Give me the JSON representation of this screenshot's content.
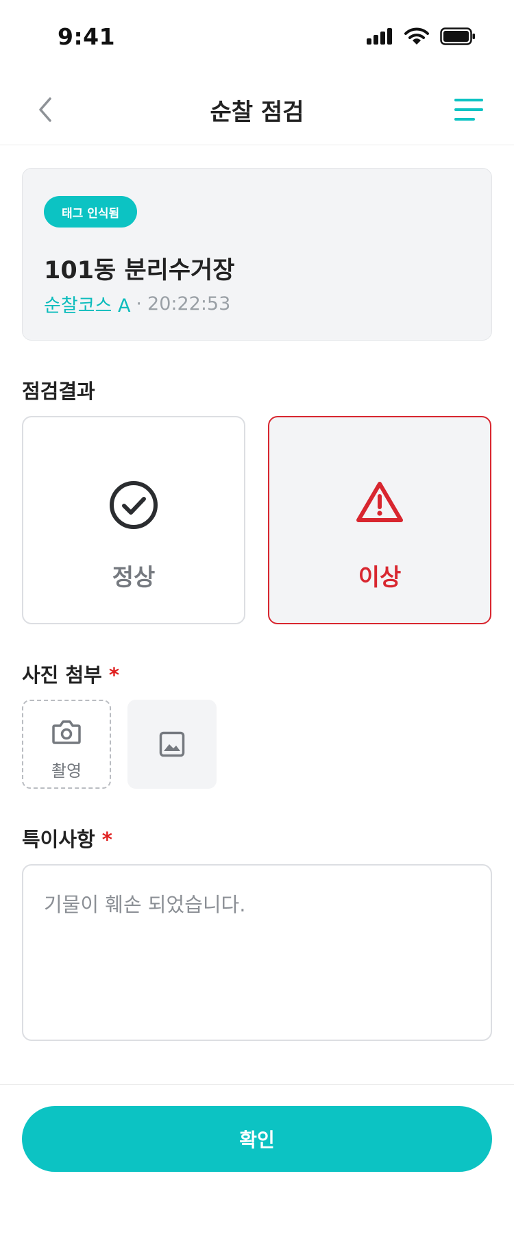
{
  "status_bar": {
    "time": "9:41"
  },
  "nav": {
    "title": "순찰 점검",
    "back_icon": "chevron-left-icon",
    "menu_icon": "menu-icon"
  },
  "tag_card": {
    "badge": "태그 인식됨",
    "location": "101동 분리수거장",
    "course": "순찰코스 A",
    "separator": "·",
    "time": "20:22:53"
  },
  "result": {
    "label": "점검결과",
    "options": [
      {
        "label": "정상",
        "icon": "check-circle-icon",
        "selected": false
      },
      {
        "label": "이상",
        "icon": "warning-triangle-icon",
        "selected": true
      }
    ]
  },
  "photo": {
    "label": "사진 첨부",
    "required_mark": "*",
    "capture_label": "촬영",
    "capture_icon": "camera-icon",
    "thumbnail_icon": "image-icon"
  },
  "notes": {
    "label": "특이사항",
    "required_mark": "*",
    "value": "기물이 훼손 되었습니다."
  },
  "confirm": {
    "label": "확인"
  },
  "colors": {
    "accent": "#0cc3c3",
    "danger": "#d8262f",
    "card_bg": "#f3f4f6"
  }
}
